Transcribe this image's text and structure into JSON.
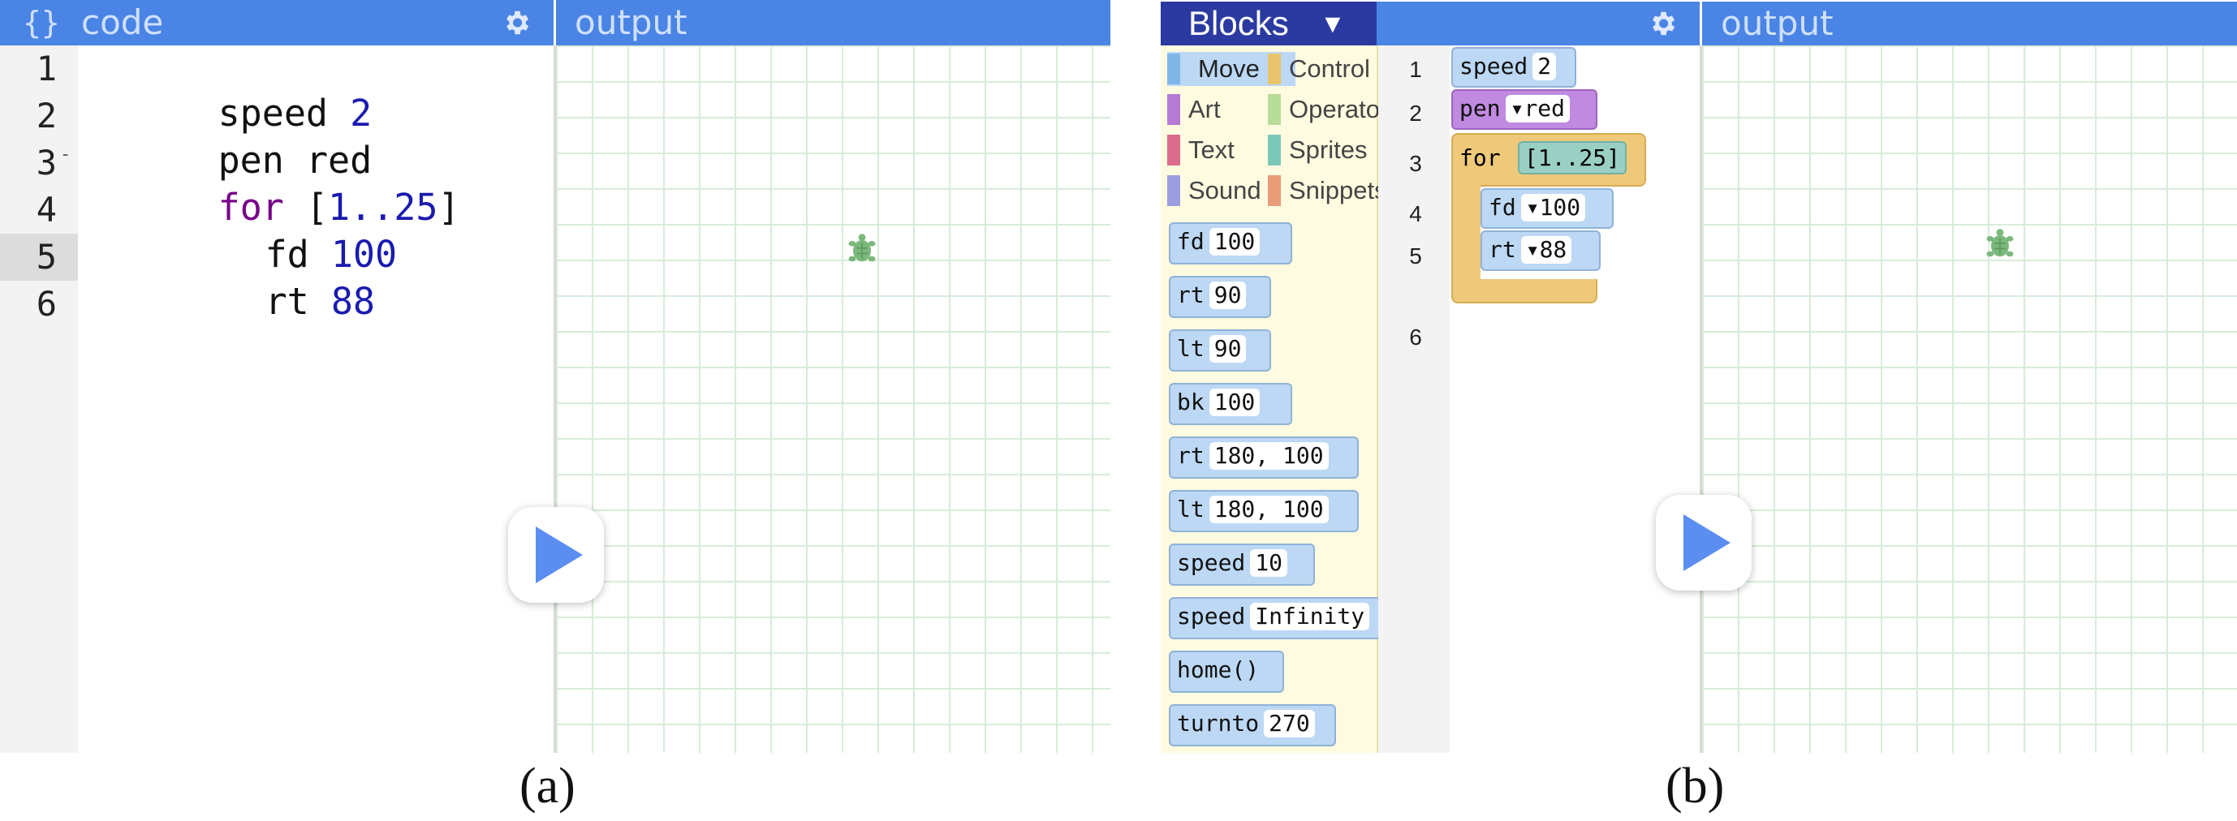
{
  "panel_a": {
    "code_header": {
      "icon": "{}",
      "title": "code"
    },
    "output_header": {
      "title": "output"
    },
    "line_numbers": [
      "1",
      "2",
      "3",
      "4",
      "5",
      "6"
    ],
    "fold_marker": "-",
    "code_lines": [
      {
        "kw": "speed",
        "arg": "2"
      },
      {
        "kw": "pen",
        "arg": "red"
      },
      {
        "kw": "for",
        "open": "[",
        "arg": "1..25",
        "close": "]"
      },
      {
        "kw": "fd",
        "arg": "100"
      },
      {
        "kw": "rt",
        "arg": "88"
      }
    ],
    "caption": "(a)"
  },
  "panel_b": {
    "blocks_menu": {
      "label": "Blocks",
      "arrow": "▼"
    },
    "output_header": {
      "title": "output"
    },
    "categories": [
      {
        "label": "Move",
        "color": "#7eb6e8"
      },
      {
        "label": "Control",
        "color": "#e8c46c"
      },
      {
        "label": "Art",
        "color": "#b47ad4"
      },
      {
        "label": "Operato",
        "color": "#b8dc9a"
      },
      {
        "label": "Text",
        "color": "#dc6c8c"
      },
      {
        "label": "Sprites",
        "color": "#7cc8b8"
      },
      {
        "label": "Sound",
        "color": "#9c9ce0"
      },
      {
        "label": "Snippets",
        "color": "#e89c78"
      }
    ],
    "palette_blocks": [
      {
        "cmd": "fd",
        "arg": "100"
      },
      {
        "cmd": "rt",
        "arg": "90"
      },
      {
        "cmd": "lt",
        "arg": "90"
      },
      {
        "cmd": "bk",
        "arg": "100"
      },
      {
        "cmd": "rt",
        "arg": "180, 100"
      },
      {
        "cmd": "lt",
        "arg": "180, 100"
      },
      {
        "cmd": "speed",
        "arg": "10"
      },
      {
        "cmd": "speed",
        "arg": "Infinity"
      },
      {
        "cmd": "home()",
        "arg": ""
      },
      {
        "cmd": "turnto",
        "arg": "270"
      }
    ],
    "workspace_line_numbers": [
      "1",
      "2",
      "3",
      "4",
      "5",
      "6"
    ],
    "workspace": {
      "speed": {
        "cmd": "speed",
        "arg": "2"
      },
      "pen": {
        "cmd": "pen",
        "arg": "red",
        "dropdown": "▾"
      },
      "for": {
        "cmd": "for",
        "arg": "[1..25]"
      },
      "fd": {
        "cmd": "fd",
        "arg": "100",
        "dropdown": "▾"
      },
      "rt": {
        "cmd": "rt",
        "arg": "88",
        "dropdown": "▾"
      }
    },
    "caption": "(b)"
  },
  "colors": {
    "header_bar": "#4a84e4",
    "keyword": "#770088",
    "number": "#1a1ab0",
    "grid_line": "#d7ecd9",
    "play_icon": "#5b8ef0",
    "turtle": "#7cb87c"
  }
}
